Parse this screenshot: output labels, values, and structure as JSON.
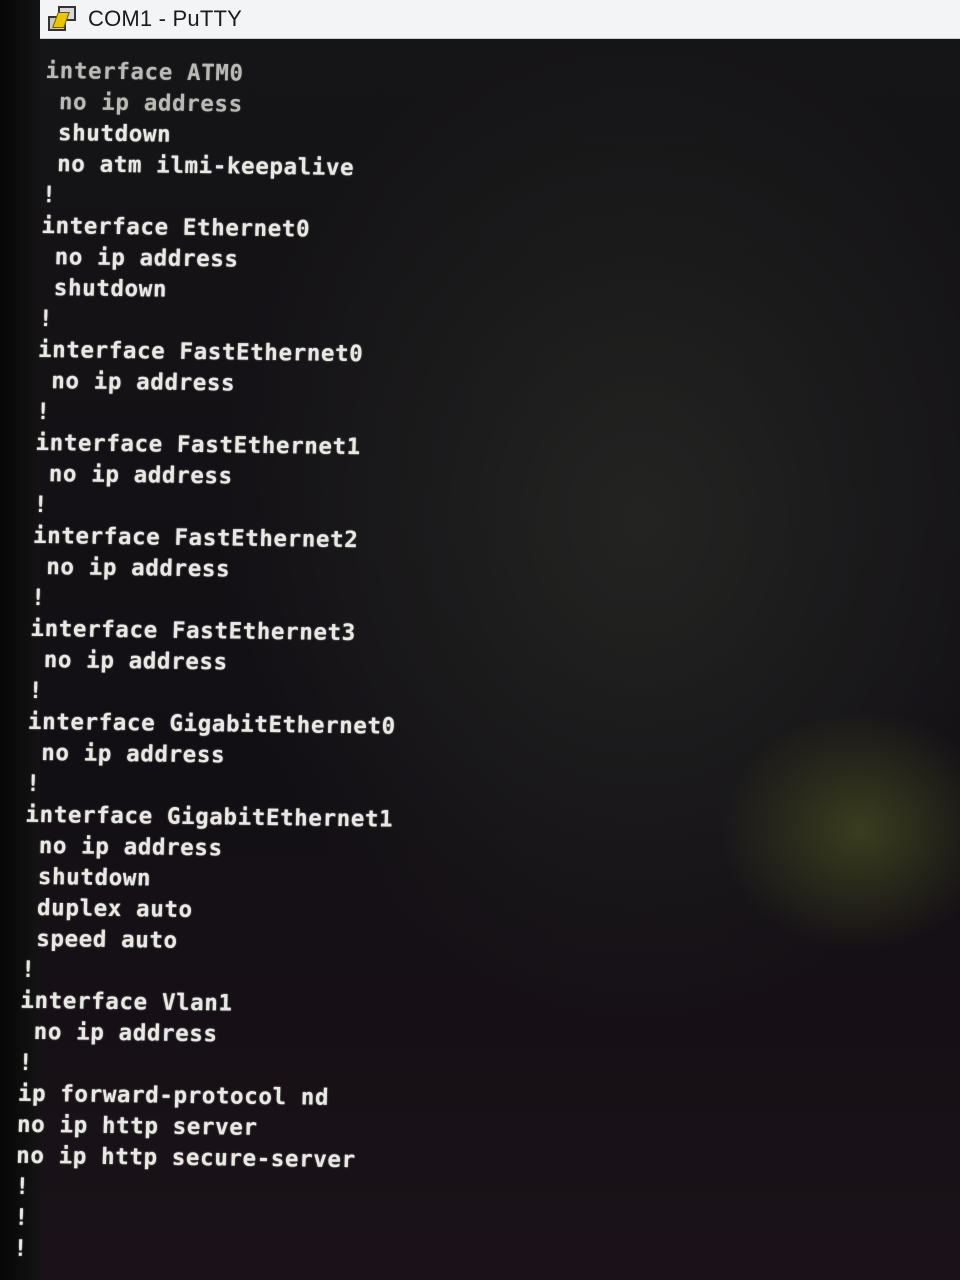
{
  "window": {
    "title": "COM1 - PuTTY",
    "icon": "putty-icon"
  },
  "terminal": {
    "lines": [
      "interface ATM0",
      " no ip address",
      " shutdown",
      " no atm ilmi-keepalive",
      "!",
      "interface Ethernet0",
      " no ip address",
      " shutdown",
      "!",
      "interface FastEthernet0",
      " no ip address",
      "!",
      "interface FastEthernet1",
      " no ip address",
      "!",
      "interface FastEthernet2",
      " no ip address",
      "!",
      "interface FastEthernet3",
      " no ip address",
      "!",
      "interface GigabitEthernet0",
      " no ip address",
      "!",
      "interface GigabitEthernet1",
      " no ip address",
      " shutdown",
      " duplex auto",
      " speed auto",
      "!",
      "interface Vlan1",
      " no ip address",
      "!",
      "ip forward-protocol nd",
      "no ip http server",
      "no ip http secure-server",
      "!",
      "!",
      "!"
    ]
  }
}
